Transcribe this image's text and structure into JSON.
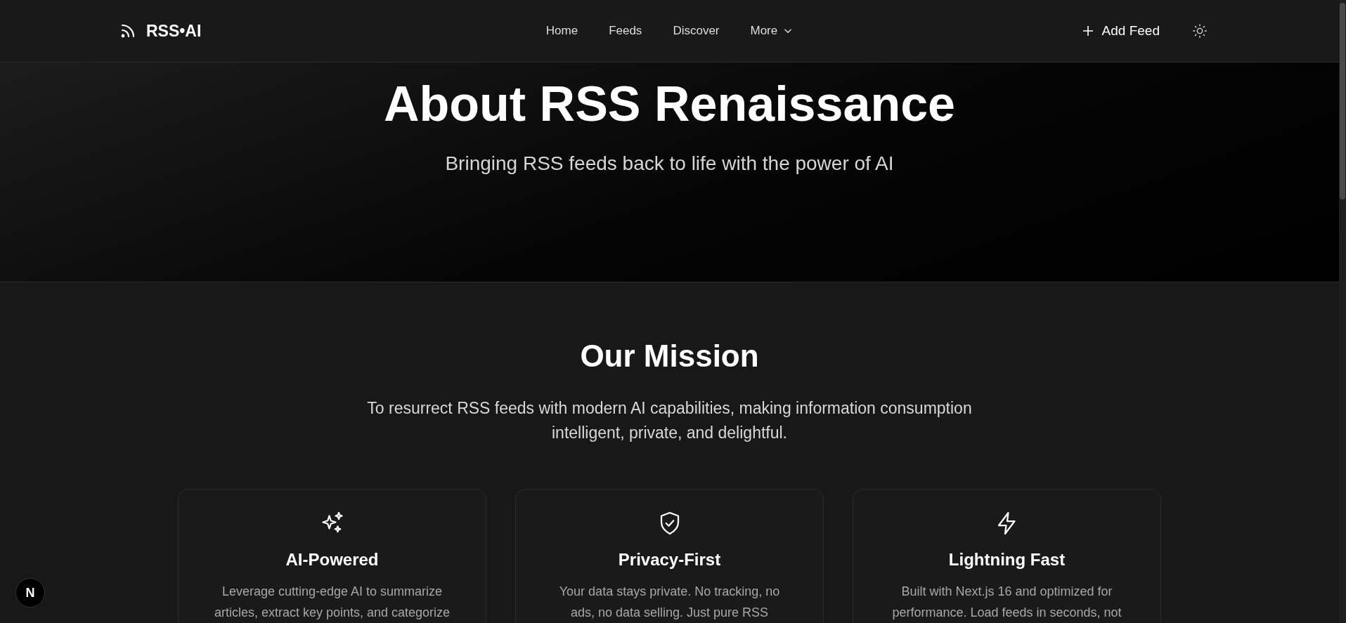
{
  "header": {
    "logo": "RSS•AI",
    "nav": [
      {
        "label": "Home"
      },
      {
        "label": "Feeds"
      },
      {
        "label": "Discover"
      },
      {
        "label": "More",
        "dropdown": true
      }
    ],
    "add_button": "Add Feed"
  },
  "hero": {
    "title": "About RSS Renaissance",
    "subtitle": "Bringing RSS feeds back to life with the power of AI"
  },
  "mission": {
    "title": "Our Mission",
    "text": "To resurrect RSS feeds with modern AI capabilities, making information consumption intelligent, private, and delightful.",
    "cards": [
      {
        "kind": "sparkles",
        "title": "AI-Powered",
        "lines": [
          "Leverage cutting-edge AI to summarize",
          "articles, extract key points, and categorize"
        ]
      },
      {
        "kind": "shield",
        "title": "Privacy-First",
        "lines": [
          "Your data stays private. No tracking, no",
          "ads, no data selling. Just pure RSS"
        ]
      },
      {
        "kind": "bolt",
        "title": "Lightning Fast",
        "lines": [
          "Built with Next.js 16 and optimized for",
          "performance. Load feeds in seconds, not"
        ]
      }
    ]
  },
  "dev_badge": "N"
}
